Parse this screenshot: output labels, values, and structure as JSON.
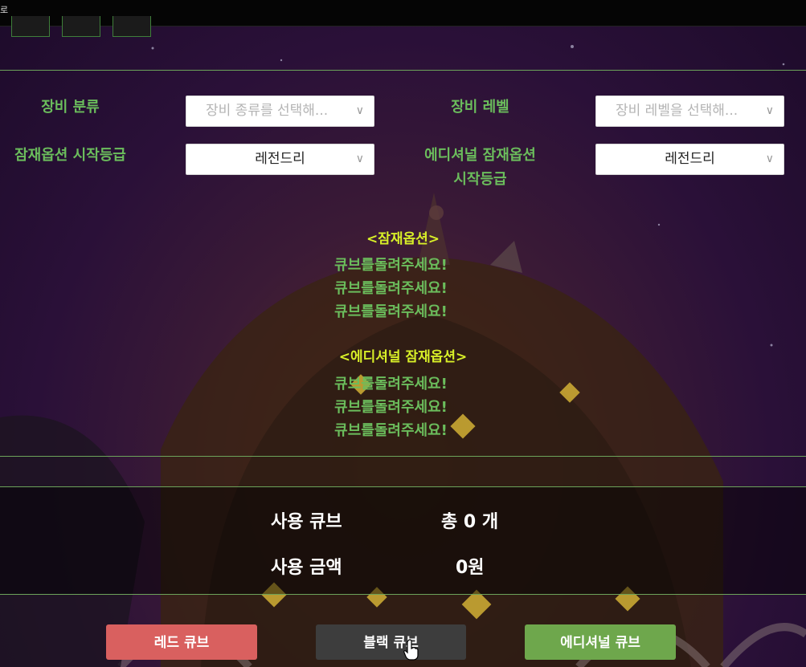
{
  "window": {
    "title": "로"
  },
  "filters": {
    "equip_type": {
      "label": "장비 분류",
      "placeholder": "장비 종류를 선택해...",
      "chevron_icon": "chevron-down-icon"
    },
    "equip_level": {
      "label": "장비 레벨",
      "placeholder": "장비 레벨을 선택해...",
      "chevron_icon": "chevron-down-icon"
    },
    "potential_grade": {
      "label": "잠재옵션 시작등급",
      "value": "레전드리"
    },
    "additional_grade": {
      "label_line1": "에디셔널 잠재옵션",
      "label_line2": "시작등급",
      "value": "레전드리"
    }
  },
  "potential": {
    "title": "<잠재옵션>",
    "lines": [
      "큐브를돌려주세요!",
      "큐브를돌려주세요!",
      "큐브를돌려주세요!"
    ]
  },
  "additional": {
    "title": "<에디셔널 잠재옵션>",
    "lines": [
      "큐브를돌려주세요!",
      "큐브를돌려주세요!",
      "큐브를돌려주세요!"
    ]
  },
  "stats": {
    "used_cubes_label": "사용 큐브",
    "used_cubes_value": "총 0 개",
    "used_money_label": "사용 금액",
    "used_money_value": "0원"
  },
  "buttons": {
    "red": "레드 큐브",
    "black": "블랙 큐브",
    "additional": "에디셔널 큐브"
  },
  "colors": {
    "label_green": "#6bbd5c",
    "section_yellow": "#d8ef28",
    "red_button": "#d9605f",
    "black_button": "#3d3d3d",
    "additional_button": "#6ea74c"
  }
}
